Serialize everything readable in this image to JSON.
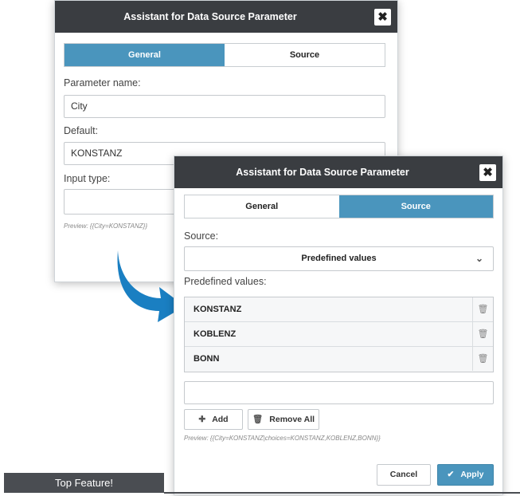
{
  "dialog_general": {
    "title": "Assistant for Data Source Parameter",
    "close_label": "✖",
    "tabs": [
      {
        "label": "General",
        "active": true
      },
      {
        "label": "Source",
        "active": false
      }
    ],
    "param_name_label": "Parameter name:",
    "param_name_value": "City",
    "default_label": "Default:",
    "default_value": "KONSTANZ",
    "input_type_label": "Input type:",
    "input_type_value": "",
    "preview": "Preview: {{City=KONSTANZ}}"
  },
  "dialog_source": {
    "title": "Assistant for Data Source Parameter",
    "close_label": "✖",
    "tabs": [
      {
        "label": "General",
        "active": false
      },
      {
        "label": "Source",
        "active": true
      }
    ],
    "source_label": "Source:",
    "source_value": "Predefined values",
    "predefined_label": "Predefined values:",
    "values": [
      "KONSTANZ",
      "KOBLENZ",
      "BONN"
    ],
    "new_value_input": "",
    "add_label": "Add",
    "remove_all_label": "Remove All",
    "preview": "Preview: {{City=KONSTANZ|choices=KONSTANZ,KOBLENZ,BONN}}",
    "cancel_label": "Cancel",
    "apply_label": "Apply"
  },
  "badge": "Top Feature!",
  "colors": {
    "accent": "#4a95bd",
    "titlebar": "#3a3d41",
    "arrow": "#1a7fc2",
    "badge": "#4a4d52"
  },
  "icons": [
    "close-icon",
    "chevron-down-icon",
    "trash-icon",
    "plus-icon",
    "check-icon",
    "curved-arrow-icon"
  ]
}
